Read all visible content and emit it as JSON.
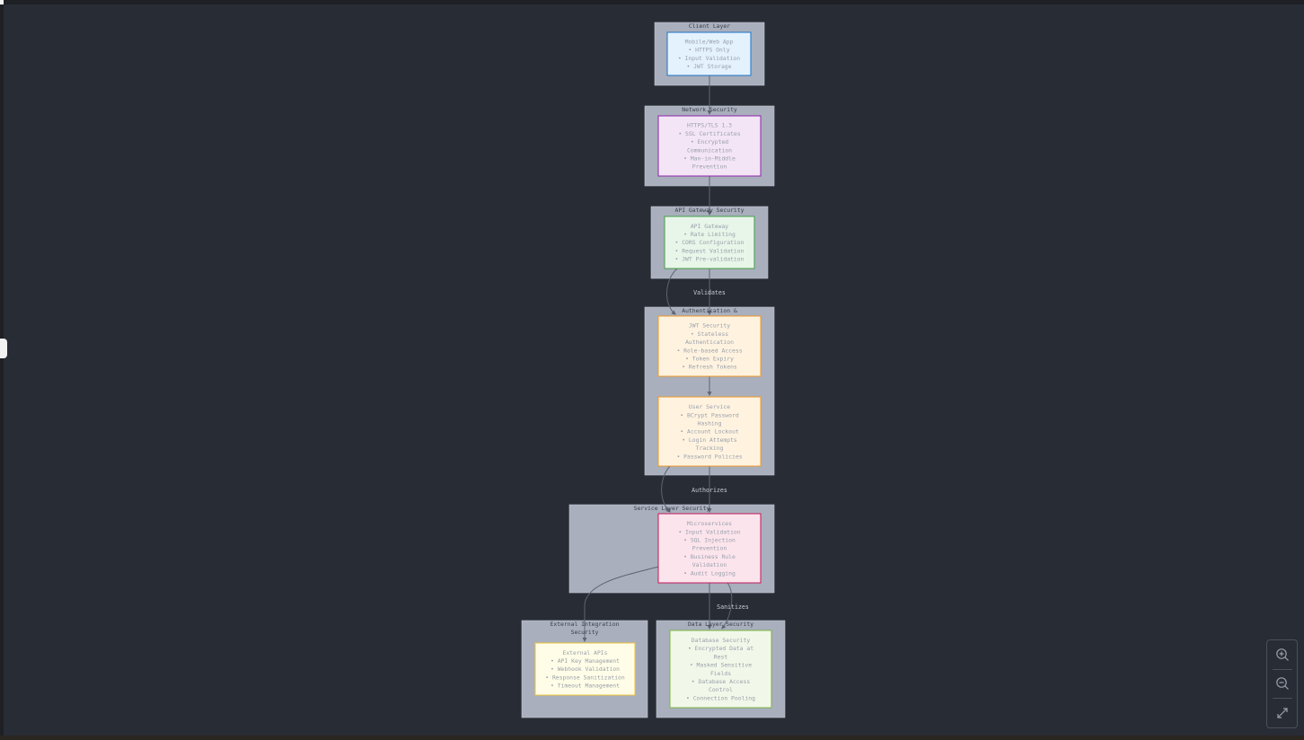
{
  "groups": [
    {
      "id": "client",
      "title": "Client Layer"
    },
    {
      "id": "network",
      "title": "Network Security"
    },
    {
      "id": "gateway",
      "title": "API Gateway Security"
    },
    {
      "id": "auth",
      "title": "Authentication &"
    },
    {
      "id": "service",
      "title": "Service Layer Security"
    },
    {
      "id": "external",
      "title_lines": [
        "External Integration",
        "Security"
      ]
    },
    {
      "id": "data",
      "title": "Data Layer Security"
    }
  ],
  "nodes": [
    {
      "id": "mobile",
      "lines": [
        "Mobile/Web App",
        "• HTTPS Only",
        "• Input Validation",
        "• JWT Storage"
      ]
    },
    {
      "id": "https",
      "lines": [
        "HTTPS/TLS 1.3",
        "• SSL Certificates",
        "• Encrypted",
        "Communication",
        "• Man-in-Middle",
        "Prevention"
      ]
    },
    {
      "id": "apigw",
      "lines": [
        "API Gateway",
        "• Rate Limiting",
        "• CORS Configuration",
        "• Request Validation",
        "• JWT Pre-validation"
      ]
    },
    {
      "id": "jwt",
      "lines": [
        "JWT Security",
        "• Stateless",
        "Authentication",
        "• Role-based Access",
        "• Token Expiry",
        "• Refresh Tokens"
      ]
    },
    {
      "id": "user",
      "lines": [
        "User Service",
        "• BCrypt Password",
        "Hashing",
        "• Account Lockout",
        "• Login Attempts",
        "Tracking",
        "• Password Policies"
      ]
    },
    {
      "id": "micro",
      "lines": [
        "Microservices",
        "• Input Validation",
        "• SQL Injection",
        "Prevention",
        "• Business Rule",
        "Validation",
        "• Audit Logging"
      ]
    },
    {
      "id": "ext",
      "lines": [
        "External APIs",
        "• API Key Management",
        "• Webhook Validation",
        "• Response Sanitization",
        "• Timeout Management"
      ]
    },
    {
      "id": "db",
      "lines": [
        "Database Security",
        "• Encrypted Data at",
        "Rest",
        "• Masked Sensitive",
        "Fields",
        "• Database Access",
        "Control",
        "• Connection Pooling"
      ]
    }
  ],
  "edge_labels": {
    "validates": "Validates",
    "authorizes": "Authorizes",
    "sanitizes": "Sanitizes"
  },
  "controls": {
    "zoom_in_icon": "zoom-in-icon",
    "zoom_out_icon": "zoom-out-icon",
    "fit_icon": "expand-icon"
  },
  "colors": {
    "canvas": "#282c35",
    "group_fill": "#a9afbc",
    "edge": "#5e6472",
    "client": {
      "fill": "#e3f2fd",
      "stroke": "#1e73c8"
    },
    "network": {
      "fill": "#f3e5f5",
      "stroke": "#8e24aa"
    },
    "gateway": {
      "fill": "#e8f5e9",
      "stroke": "#43a047"
    },
    "auth": {
      "fill": "#fff3e0",
      "stroke": "#f09a2a"
    },
    "service": {
      "fill": "#fce4ec",
      "stroke": "#c2185b"
    },
    "external": {
      "fill": "#fffde7",
      "stroke": "#f0c43c"
    },
    "data": {
      "fill": "#f1f8e9",
      "stroke": "#7cb342"
    }
  }
}
